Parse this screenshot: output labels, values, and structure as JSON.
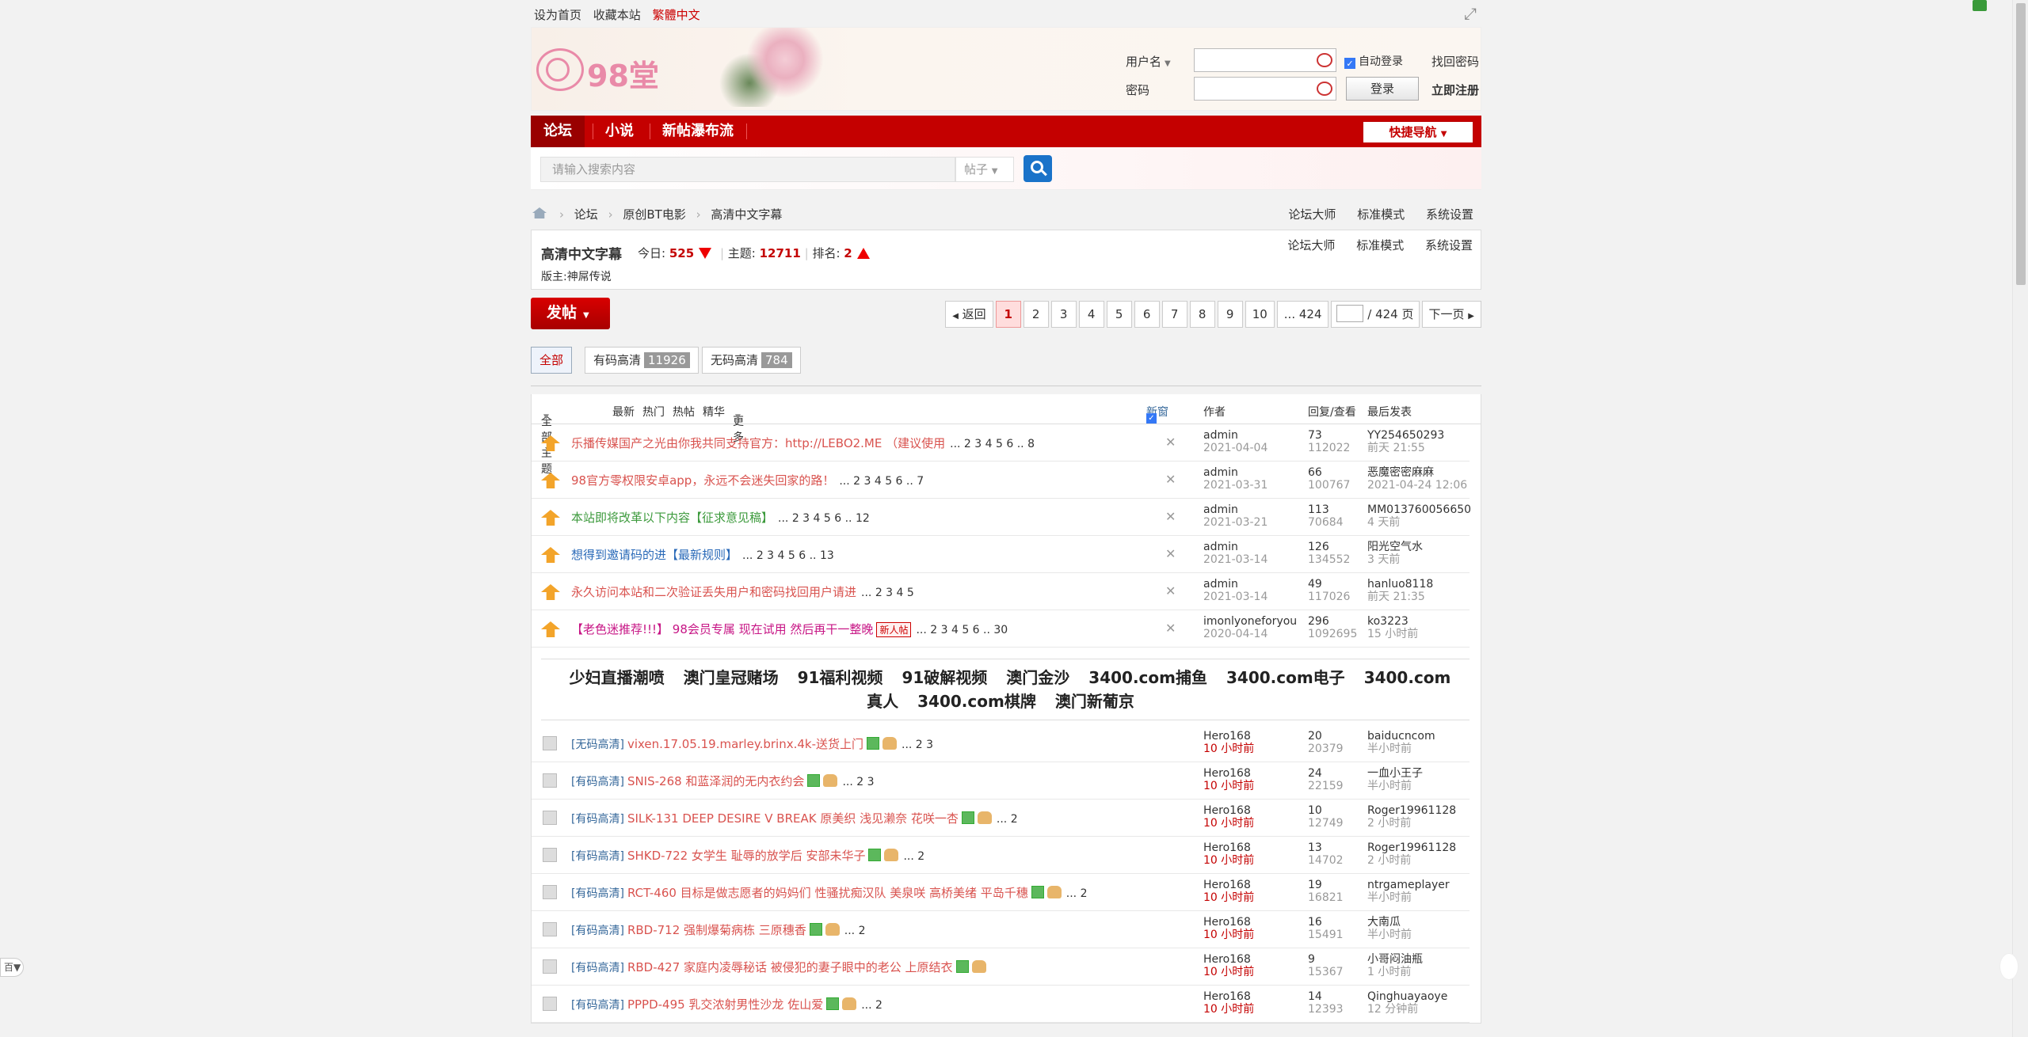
{
  "topbar": {
    "links": [
      "设为首页",
      "收藏本站",
      "繁體中文"
    ]
  },
  "header": {
    "logo_text": "98堂",
    "login": {
      "username_label": "用户名",
      "password_label": "密码",
      "auto_login": "自动登录",
      "login_button": "登录",
      "find_password": "找回密码",
      "register": "立即注册"
    }
  },
  "nav": {
    "items": [
      "论坛",
      "小说",
      "新帖瀑布流"
    ],
    "quick_nav": "快捷导航"
  },
  "search": {
    "placeholder": "请输入搜索内容",
    "type": "帖子"
  },
  "breadcrumb": {
    "items": [
      "论坛",
      "原创BT电影",
      "高清中文字幕"
    ],
    "right": [
      "论坛大师",
      "标准模式",
      "系统设置"
    ]
  },
  "forum": {
    "name": "高清中文字幕",
    "today_label": "今日:",
    "today_value": "525",
    "topics_label": "主题:",
    "topics_value": "12711",
    "rank_label": "排名:",
    "rank_value": "2",
    "moderator_label": "版主:",
    "moderator": "神屌传说",
    "right": [
      "论坛大师",
      "标准模式",
      "系统设置"
    ]
  },
  "pager": {
    "post_button": "发帖",
    "back": "返回",
    "pages": [
      "1",
      "2",
      "3",
      "4",
      "5",
      "6",
      "7",
      "8",
      "9",
      "10",
      "... 424"
    ],
    "total": "/ 424 页",
    "next": "下一页"
  },
  "filters": {
    "all": "全部",
    "coded": "有码高清",
    "coded_count": "11926",
    "uncoded": "无码高清",
    "uncoded_count": "784"
  },
  "thead": {
    "all_topics": "全部主题",
    "sorts": [
      "最新",
      "热门",
      "热帖",
      "精华",
      "更多"
    ],
    "new_window": "新窗",
    "author": "作者",
    "replies_views": "回复/查看",
    "last_post": "最后发表"
  },
  "sticky": [
    {
      "title": "乐播传媒国产之光由你我共同支持官方：http://LEBO2.ME （建议使用",
      "color": "#d9534f",
      "pages": "... 2 3 4 5 6 .. 8",
      "author": "admin",
      "date": "2021-04-04",
      "replies": "73",
      "views": "112022",
      "last_user": "YY254650293",
      "last_time": "前天 21:55"
    },
    {
      "title": "98官方零权限安卓app，永远不会迷失回家的路！",
      "color": "#d9534f",
      "pages": "... 2 3 4 5 6 .. 7",
      "author": "admin",
      "date": "2021-03-31",
      "replies": "66",
      "views": "100767",
      "last_user": "恶魔密密麻麻",
      "last_time": "2021-04-24 12:06"
    },
    {
      "title": "本站即将改革以下内容【征求意见稿】",
      "color": "#3c9a3c",
      "pages": "... 2 3 4 5 6 .. 12",
      "author": "admin",
      "date": "2021-03-21",
      "replies": "113",
      "views": "70684",
      "last_user": "MM013760056650",
      "last_time": "4 天前"
    },
    {
      "title": "想得到邀请码的进【最新规则】",
      "color": "#2a6ab8",
      "pages": "... 2 3 4 5 6 .. 13",
      "author": "admin",
      "date": "2021-03-14",
      "replies": "126",
      "views": "134552",
      "last_user": "阳光空气水",
      "last_time": "3 天前"
    },
    {
      "title": "永久访问本站和二次验证丢失用户和密码找回用户请进",
      "color": "#d9534f",
      "pages": "... 2 3 4 5",
      "author": "admin",
      "date": "2021-03-14",
      "replies": "49",
      "views": "117026",
      "last_user": "hanluo8118",
      "last_time": "前天 21:35"
    },
    {
      "title": "【老色迷推荐!!!】 98会员专属 现在试用 然后再干一整晚",
      "color": "#c71585",
      "pages": "... 2 3 4 5 6 .. 30",
      "tag": "新人帖",
      "author": "imonlyoneforyou",
      "date": "2020-04-14",
      "replies": "296",
      "views": "1092695",
      "last_user": "ko3223",
      "last_time": "15 小时前"
    }
  ],
  "ads": [
    "少妇直播潮喷",
    "澳门皇冠赌场",
    "91福利视频",
    "91破解视频",
    "澳门金沙",
    "3400.com捕鱼",
    "3400.com电子",
    "3400.com真人",
    "3400.com棋牌",
    "澳门新葡京"
  ],
  "threads": [
    {
      "cat": "[无码高清]",
      "title": "vixen.17.05.19.marley.brinx.4k-送货上门",
      "pages": "... 2 3",
      "author": "Hero168",
      "date": "10 小时前",
      "replies": "20",
      "views": "20379",
      "last_user": "baiducncom",
      "last_time": "半小时前"
    },
    {
      "cat": "[有码高清]",
      "title": "SNIS-268 和蓝泽润的无内衣约会",
      "pages": "... 2 3",
      "author": "Hero168",
      "date": "10 小时前",
      "replies": "24",
      "views": "22159",
      "last_user": "一血小王子",
      "last_time": "半小时前"
    },
    {
      "cat": "[有码高清]",
      "title": "SILK-131 DEEP DESIRE V BREAK 原美织 浅见濑奈 花咲一杏",
      "pages": "... 2",
      "author": "Hero168",
      "date": "10 小时前",
      "replies": "10",
      "views": "12749",
      "last_user": "Roger19961128",
      "last_time": "2 小时前"
    },
    {
      "cat": "[有码高清]",
      "title": "SHKD-722 女学生 耻辱的放学后 安部未华子",
      "pages": "... 2",
      "author": "Hero168",
      "date": "10 小时前",
      "replies": "13",
      "views": "14702",
      "last_user": "Roger19961128",
      "last_time": "2 小时前"
    },
    {
      "cat": "[有码高清]",
      "title": "RCT-460 目标是做志愿者的妈妈们 性骚扰痴汉队 美泉咲 高桥美绪 平岛千穗",
      "pages": "... 2",
      "author": "Hero168",
      "date": "10 小时前",
      "replies": "19",
      "views": "16821",
      "last_user": "ntrgameplayer",
      "last_time": "半小时前"
    },
    {
      "cat": "[有码高清]",
      "title": "RBD-712 强制爆菊病栋 三原穗香",
      "pages": "... 2",
      "author": "Hero168",
      "date": "10 小时前",
      "replies": "16",
      "views": "15491",
      "last_user": "大南瓜",
      "last_time": "半小时前"
    },
    {
      "cat": "[有码高清]",
      "title": "RBD-427 家庭内凌辱秘话 被侵犯的妻子眼中的老公 上原结衣",
      "pages": "",
      "author": "Hero168",
      "date": "10 小时前",
      "replies": "9",
      "views": "15367",
      "last_user": "小哥闷油瓶",
      "last_time": "1 小时前"
    },
    {
      "cat": "[有码高清]",
      "title": "PPPD-495 乳交浓射男性沙龙 佐山爱",
      "pages": "... 2",
      "author": "Hero168",
      "date": "10 小时前",
      "replies": "14",
      "views": "12393",
      "last_user": "Qinghuayaoye",
      "last_time": "12 分钟前"
    }
  ],
  "colors": {
    "nav_red": "#c40000",
    "link_red": "#d9534f"
  }
}
